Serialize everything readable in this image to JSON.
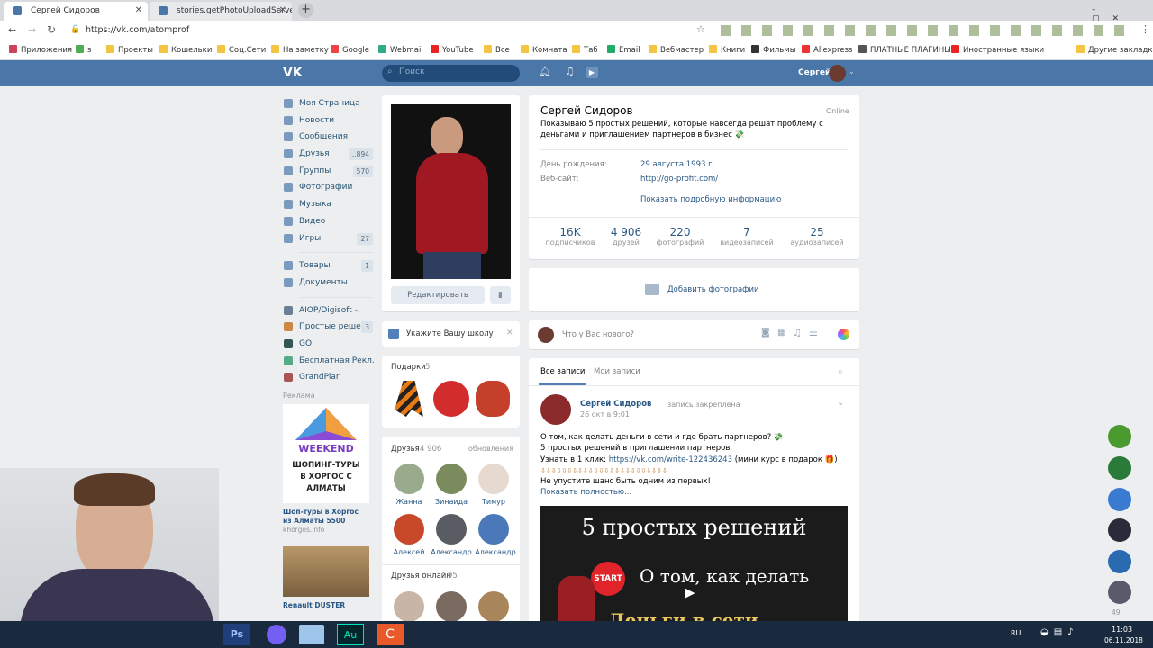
{
  "browser": {
    "tabs": [
      {
        "label": "Сергей Сидоров"
      },
      {
        "label": "stories.getPhotoUploadServer | F"
      }
    ],
    "url": "https://vk.com/atomprof"
  },
  "bookmarks": [
    "Приложения",
    "s",
    "Проекты",
    "Кошельки",
    "Соц.Сети",
    "На заметку",
    "Google",
    "Webmail",
    "YouTube",
    "Все",
    "Комната",
    "Таб",
    "Email",
    "Вебмастер",
    "Книги",
    "Фильмы",
    "Aliexpress",
    "ПЛАТНЫЕ ПЛАГИНЫ",
    "Иностранные языки",
    "Другие закладки"
  ],
  "header": {
    "search_placeholder": "Поиск",
    "user_name": "Сергей"
  },
  "nav": {
    "items": [
      {
        "label": "Моя Страница"
      },
      {
        "label": "Новости"
      },
      {
        "label": "Сообщения"
      },
      {
        "label": "Друзья",
        "count": "..894"
      },
      {
        "label": "Группы",
        "count": "570"
      },
      {
        "label": "Фотографии"
      },
      {
        "label": "Музыка"
      },
      {
        "label": "Видео"
      },
      {
        "label": "Игры",
        "count": "27"
      }
    ],
    "items2": [
      {
        "label": "Товары",
        "count": "1"
      },
      {
        "label": "Документы"
      }
    ],
    "apps": [
      {
        "label": "AIOP/Digisoft -."
      },
      {
        "label": "Простые реше...",
        "count": "3"
      },
      {
        "label": "GO"
      },
      {
        "label": "Бесплатная Рекл."
      },
      {
        "label": "GrandPiar"
      }
    ],
    "ads_label": "Реклама",
    "ad1": {
      "weekend": "WEEKEND",
      "banner": "ШОПИНГ-ТУРЫ В ХОРГОС С АЛМАТЫ",
      "title": "Шоп-туры в Хоргос из Алматы 5500",
      "domain": "khorgos.info"
    },
    "ad2": {
      "title": "Renault DUSTER"
    }
  },
  "profile": {
    "edit_label": "Редактировать",
    "school_label": "Укажите Вашу школу",
    "gifts_label": "Подарки",
    "gifts_count": "5",
    "friends_label": "Друзья",
    "friends_count": "4 906",
    "friends_updates": "обновления",
    "friends": [
      "Жанна",
      "Зинаида",
      "Тимур",
      "Алексей",
      "Александр",
      "Александр"
    ],
    "online_label": "Друзья онлайн",
    "online_count": "95"
  },
  "info": {
    "name": "Сергей Сидоров",
    "status_online": "Online",
    "status": "Показываю 5 простых решений, которые навсегда решат проблему с деньгами и приглашением партнеров в бизнес 💸",
    "birthday_label": "День рождения:",
    "birthday": "29 августа 1993 г.",
    "site_label": "Веб-сайт:",
    "site": "http://go-profit.com/",
    "more": "Показать подробную информацию",
    "stats": [
      {
        "value": "16K",
        "label": "подписчиков"
      },
      {
        "value": "4 906",
        "label": "друзей"
      },
      {
        "value": "220",
        "label": "фотографий"
      },
      {
        "value": "7",
        "label": "видеозаписей"
      },
      {
        "value": "25",
        "label": "аудиозаписей"
      }
    ],
    "add_photos": "Добавить фотографии"
  },
  "composer": {
    "placeholder": "Что у Вас нового?"
  },
  "wall": {
    "tab_all": "Все записи",
    "tab_mine": "Мои записи",
    "post": {
      "author": "Сергей Сидоров",
      "pinned": "запись закреплена",
      "date": "26 окт в 9:01",
      "line1": "О том, как делать деньги в сети и где брать партнеров? 💸",
      "line2": "5 простых решений в приглашении партнеров.",
      "line3_prefix": "Узнать в 1 клик:",
      "link": "https://vk.com/write-122436243",
      "line3_suffix": "(мини курс в подарок 🎁)",
      "arrows": "⇩⇩⇩⇩⇩⇩⇩⇩⇩⇩⇩⇩⇩⇩⇩⇩⇩⇩⇩⇩⇩⇩⇩⇩⇩⇩⇩⇩",
      "line4": "Не упустите шанс быть одним из первых!",
      "more": "Показать полностью...",
      "video_title": "5 простых решений",
      "video_badge": "START",
      "video_sub": "О том, как делать",
      "video_sub2": "Деньги в сети"
    }
  },
  "right_rail": {
    "count": "49"
  },
  "taskbar": {
    "lang": "RU",
    "time": "11:03",
    "date": "06.11.2018"
  }
}
